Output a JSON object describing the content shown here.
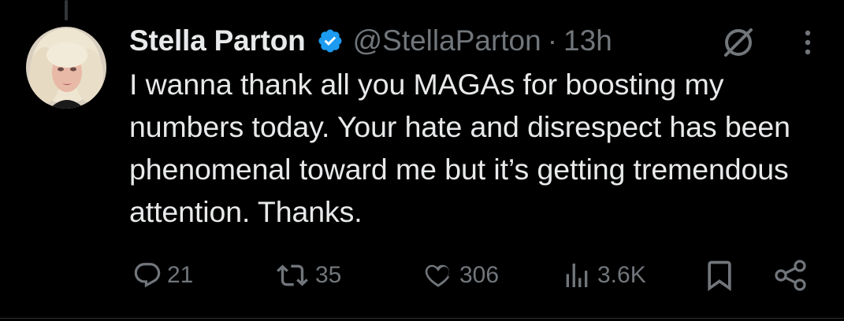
{
  "post": {
    "author": {
      "display_name": "Stella Parton",
      "verified": true,
      "handle": "@StellaParton",
      "separator": "·",
      "time": "13h"
    },
    "text": "I wanna thank all you MAGAs for boosting my numbers today. Your hate and disrespect has been phenomenal toward me but it’s getting tremendous attention. Thanks.",
    "actions": {
      "replies": "21",
      "reposts": "35",
      "likes": "306",
      "views": "3.6K"
    }
  },
  "icons": {
    "reply": "reply-icon",
    "repost": "repost-icon",
    "like": "heart-icon",
    "views": "views-icon",
    "bookmark": "bookmark-icon",
    "share": "share-icon",
    "grok": "grok-icon",
    "more": "more-icon",
    "verified": "verified-badge-icon"
  },
  "colors": {
    "background": "#000000",
    "text": "#e7e9ea",
    "muted": "#71767b",
    "verified": "#1d9bf0"
  }
}
